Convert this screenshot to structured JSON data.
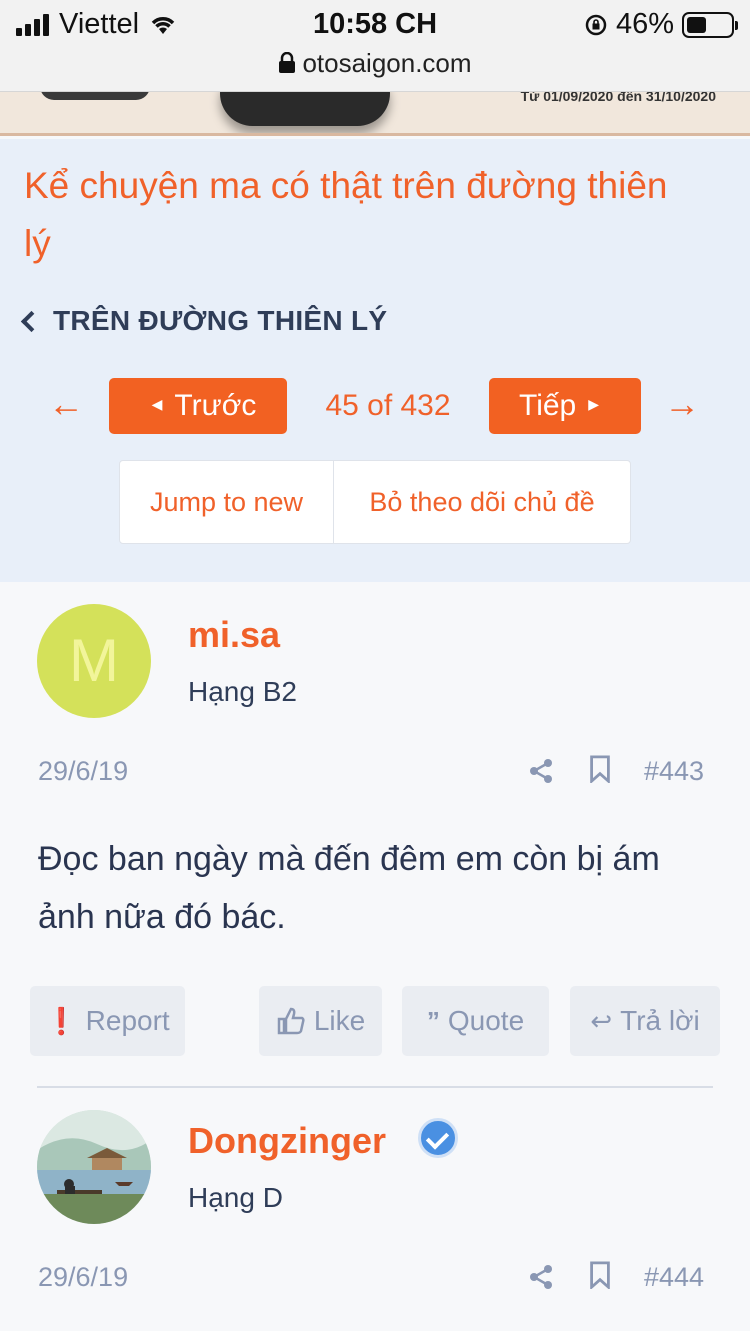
{
  "status_bar": {
    "carrier": "Viettel",
    "time": "10:58 CH",
    "battery": "46%",
    "battery_level": 0.46,
    "url": "otosaigon.com"
  },
  "banner": {
    "text": "Từ 01/09/2020 đến 31/10/2020"
  },
  "thread": {
    "title": "Kể chuyện ma có thật trên đường thiên lý",
    "breadcrumb": "TRÊN ĐƯỜNG THIÊN LÝ",
    "pager": {
      "prev": "Trước",
      "next": "Tiếp",
      "count": "45 of 432"
    },
    "actions": {
      "jump": "Jump to new",
      "unwatch": "Bỏ theo dõi chủ đề"
    }
  },
  "posts": [
    {
      "avatar_letter": "M",
      "avatar_color": "#d4e15a",
      "username": "mi.sa",
      "rank": "Hạng B2",
      "date": "29/6/19",
      "number": "#443",
      "body": "Đọc ban ngày mà đến đêm em còn bị ám ảnh nữa đó bác.",
      "buttons": {
        "report": "Report",
        "like": "Like",
        "quote": "Quote",
        "reply": "Trả lời"
      }
    },
    {
      "username": "Dongzinger",
      "verified": true,
      "rank": "Hạng D",
      "date": "29/6/19",
      "number": "#444"
    }
  ],
  "colors": {
    "accent": "#f0612a",
    "button": "#f26122",
    "header_bg": "#e8eff9",
    "muted": "#8a97b3"
  }
}
